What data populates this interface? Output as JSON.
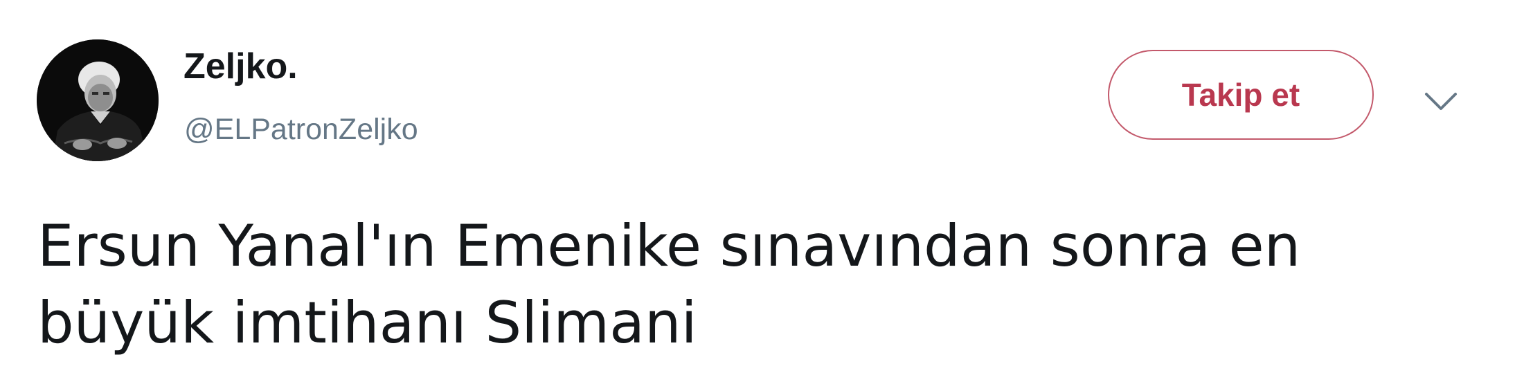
{
  "user": {
    "display_name": "Zeljko.",
    "handle": "@ELPatronZeljko",
    "avatar_icon": "profile-photo"
  },
  "actions": {
    "follow_label": "Takip et",
    "follow_color": "#b9384f",
    "menu_icon": "chevron-down-icon"
  },
  "tweet": {
    "text_line_1": "Ersun Yanal'ın Emenike sınavından sonra en",
    "text_line_2": "büyük imtihanı Slimani"
  }
}
